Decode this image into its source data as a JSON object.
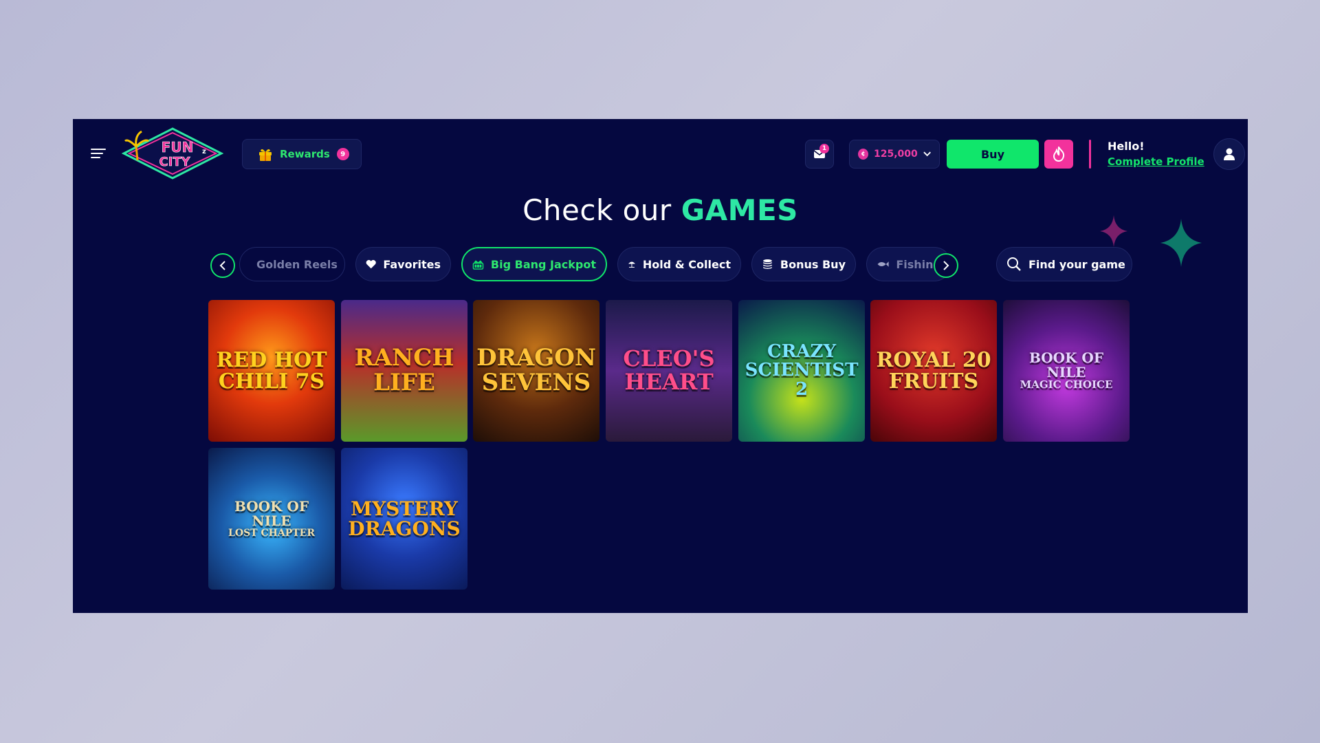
{
  "header": {
    "rewards_label": "Rewards",
    "rewards_count": "9",
    "mail_count": "1",
    "balance": "125,000",
    "buy_label": "Buy",
    "hello": "Hello!",
    "complete_profile": "Complete Profile"
  },
  "title": {
    "prefix": "Check our",
    "accent": "GAMES"
  },
  "categories": [
    {
      "label": "Golden Reels",
      "icon": "golden-reels-icon"
    },
    {
      "label": "Favorites",
      "icon": "heart-icon"
    },
    {
      "label": "Big Bang Jackpot",
      "icon": "jackpot-icon",
      "active": true
    },
    {
      "label": "Hold & Collect",
      "icon": "umbrella-icon"
    },
    {
      "label": "Bonus Buy",
      "icon": "coins-icon"
    },
    {
      "label": "Fishing",
      "icon": "fish-icon"
    }
  ],
  "search_label": "Find your game",
  "games": [
    {
      "title": "Red Hot Chili 7s",
      "line1": "RED HOT",
      "line2": "CHILI 7s"
    },
    {
      "title": "Ranch Life",
      "line1": "RANCH",
      "line2": "LIFE"
    },
    {
      "title": "Dragon Sevens",
      "line1": "DRAGON",
      "line2": "SEVENS"
    },
    {
      "title": "Cleo's Heart",
      "line1": "CLEO'S",
      "line2": "HEART"
    },
    {
      "title": "Crazy Scientist 2",
      "line1": "CRAZY",
      "line2": "SCIENTIST 2"
    },
    {
      "title": "Royal 20 Fruits",
      "line1": "ROYAL 20",
      "line2": "FRUITS"
    },
    {
      "title": "Book of Nile Magic Choice",
      "line1": "BOOK OF NILE",
      "line2": "MAGIC CHOICE"
    },
    {
      "title": "Book of Nile Lost Chapter",
      "line1": "BOOK OF NILE",
      "line2": "LOST CHAPTER"
    },
    {
      "title": "Mystery Dragons",
      "line1": "MYSTERY",
      "line2": "DRAGONS"
    }
  ],
  "colors": {
    "accent_green": "#10e66b",
    "accent_pink": "#f2329c",
    "background": "#050840"
  }
}
